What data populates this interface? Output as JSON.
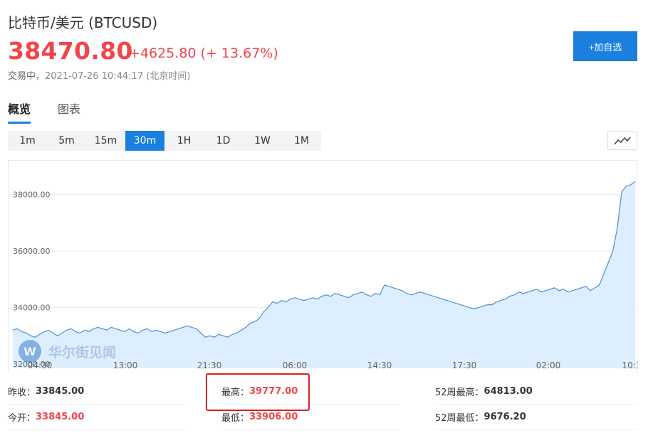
{
  "header": {
    "title": "比特币/美元 (BTCUSD)",
    "price": "38470.80",
    "change": "+4625.80 (+ 13.67%)",
    "status_label": "交易中，",
    "timestamp": "2021-07-26 10:44:17 (北京时间)",
    "add_button": "+加自选"
  },
  "tabs": [
    {
      "label": "概览",
      "active": true
    },
    {
      "label": "图表",
      "active": false
    }
  ],
  "intervals": [
    {
      "label": "1m",
      "active": false
    },
    {
      "label": "5m",
      "active": false
    },
    {
      "label": "15m",
      "active": false
    },
    {
      "label": "30m",
      "active": true
    },
    {
      "label": "1H",
      "active": false
    },
    {
      "label": "1D",
      "active": false
    },
    {
      "label": "1W",
      "active": false
    },
    {
      "label": "1M",
      "active": false
    }
  ],
  "watermark": "华尔街见闻",
  "colors": {
    "accent": "#1b7fe0",
    "up": "#f0464b",
    "line": "#4a90d9",
    "area": "#ddeefe"
  },
  "chart_data": {
    "type": "area",
    "y_ticks": [
      "32000.00",
      "34000.00",
      "36000.00",
      "38000.00"
    ],
    "y_values": [
      32000,
      34000,
      36000,
      38000
    ],
    "ylim": [
      31850,
      38950
    ],
    "x_ticks": [
      "04:30",
      "13:00",
      "21:30",
      "06:00",
      "14:30",
      "17:30",
      "02:00",
      "10:3"
    ],
    "values": [
      33200,
      33250,
      33150,
      33100,
      33000,
      32950,
      33050,
      33150,
      33200,
      33100,
      33000,
      33100,
      33200,
      33250,
      33150,
      33100,
      33200,
      33150,
      33250,
      33300,
      33250,
      33200,
      33300,
      33250,
      33200,
      33150,
      33250,
      33150,
      33100,
      33200,
      33250,
      33150,
      33200,
      33150,
      33100,
      33150,
      33200,
      33250,
      33300,
      33350,
      33300,
      33250,
      33100,
      32950,
      33000,
      32950,
      33050,
      33000,
      32950,
      33050,
      33100,
      33200,
      33300,
      33450,
      33500,
      33600,
      33850,
      34000,
      34200,
      34150,
      34250,
      34200,
      34300,
      34350,
      34300,
      34250,
      34300,
      34350,
      34300,
      34400,
      34450,
      34400,
      34500,
      34450,
      34400,
      34350,
      34450,
      34500,
      34550,
      34450,
      34400,
      34500,
      34450,
      34800,
      34750,
      34700,
      34650,
      34600,
      34500,
      34450,
      34500,
      34550,
      34500,
      34450,
      34400,
      34350,
      34300,
      34250,
      34200,
      34150,
      34100,
      34050,
      34000,
      33950,
      34000,
      34050,
      34100,
      34100,
      34200,
      34250,
      34300,
      34400,
      34450,
      34550,
      34500,
      34550,
      34600,
      34650,
      34550,
      34600,
      34650,
      34700,
      34600,
      34650,
      34550,
      34600,
      34650,
      34700,
      34750,
      34600,
      34700,
      34800,
      35200,
      35600,
      36000,
      36800,
      38100,
      38300,
      38350,
      38470
    ]
  },
  "stats": {
    "prev_close_label": "昨收：",
    "prev_close": "33845.00",
    "open_label": "今开：",
    "open": "33845.00",
    "high_label": "最高：",
    "high": "39777.00",
    "low_label": "最低：",
    "low": "33906.00",
    "w52_high_label": "52周最高：",
    "w52_high": "64813.00",
    "w52_low_label": "52周最低：",
    "w52_low": "9676.20"
  }
}
